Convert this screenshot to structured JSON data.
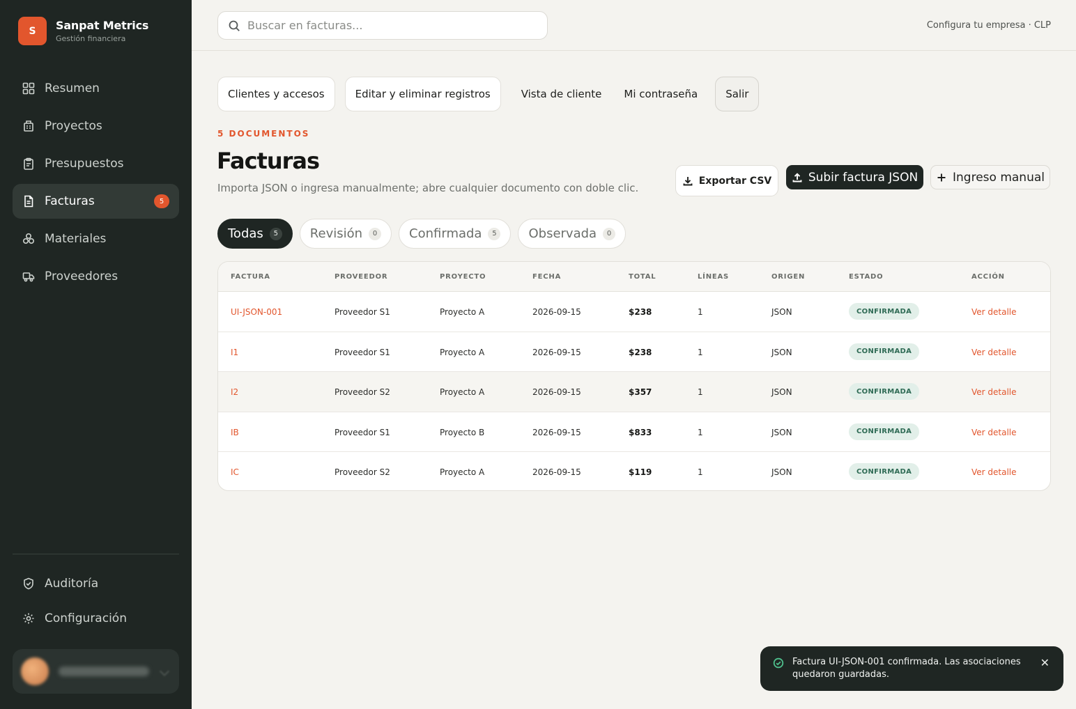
{
  "brand": {
    "logo_letter": "S",
    "name": "Sanpat Metrics",
    "subtitle": "Gestión financiera"
  },
  "sidebar": {
    "items": [
      {
        "label": "Resumen",
        "icon": "grid-icon"
      },
      {
        "label": "Proyectos",
        "icon": "building-icon"
      },
      {
        "label": "Presupuestos",
        "icon": "clipboard-icon"
      },
      {
        "label": "Facturas",
        "icon": "document-icon",
        "badge": "5",
        "active": true
      },
      {
        "label": "Materiales",
        "icon": "cluster-icon"
      },
      {
        "label": "Proveedores",
        "icon": "truck-icon"
      }
    ],
    "bottom_items": [
      {
        "label": "Auditoría",
        "icon": "shield-icon"
      },
      {
        "label": "Configuración",
        "icon": "gear-icon"
      }
    ]
  },
  "topbar": {
    "search_placeholder": "Buscar en facturas...",
    "company": "Configura tu empresa · CLP"
  },
  "top_actions": {
    "clients": "Clientes y accesos",
    "edit": "Editar y eliminar registros",
    "client_view": "Vista de cliente",
    "password": "Mi contraseña",
    "exit": "Salir"
  },
  "header": {
    "eyebrow": "5 DOCUMENTOS",
    "title": "Facturas",
    "description": "Importa JSON o ingresa manualmente; abre cualquier documento con doble clic.",
    "export_label": "Exportar CSV",
    "upload_label": "Subir factura JSON",
    "manual_label": "Ingreso manual"
  },
  "tabs": [
    {
      "label": "Todas",
      "count": "5",
      "active": true
    },
    {
      "label": "Revisión",
      "count": "0"
    },
    {
      "label": "Confirmada",
      "count": "5"
    },
    {
      "label": "Observada",
      "count": "0"
    }
  ],
  "table": {
    "columns": [
      "FACTURA",
      "PROVEEDOR",
      "PROYECTO",
      "FECHA",
      "TOTAL",
      "LÍNEAS",
      "ORIGEN",
      "ESTADO",
      "ACCIÓN"
    ],
    "rows": [
      {
        "factura": "UI-JSON-001",
        "proveedor": "Proveedor S1",
        "proyecto": "Proyecto A",
        "fecha": "2026-09-15",
        "total": "$238",
        "lineas": "1",
        "origen": "JSON",
        "estado": "CONFIRMADA",
        "accion": "Ver detalle"
      },
      {
        "factura": "I1",
        "proveedor": "Proveedor S1",
        "proyecto": "Proyecto A",
        "fecha": "2026-09-15",
        "total": "$238",
        "lineas": "1",
        "origen": "JSON",
        "estado": "CONFIRMADA",
        "accion": "Ver detalle"
      },
      {
        "factura": "I2",
        "proveedor": "Proveedor S2",
        "proyecto": "Proyecto A",
        "fecha": "2026-09-15",
        "total": "$357",
        "lineas": "1",
        "origen": "JSON",
        "estado": "CONFIRMADA",
        "accion": "Ver detalle"
      },
      {
        "factura": "IB",
        "proveedor": "Proveedor S1",
        "proyecto": "Proyecto B",
        "fecha": "2026-09-15",
        "total": "$833",
        "lineas": "1",
        "origen": "JSON",
        "estado": "CONFIRMADA",
        "accion": "Ver detalle"
      },
      {
        "factura": "IC",
        "proveedor": "Proveedor S2",
        "proyecto": "Proyecto A",
        "fecha": "2026-09-15",
        "total": "$119",
        "lineas": "1",
        "origen": "JSON",
        "estado": "CONFIRMADA",
        "accion": "Ver detalle"
      }
    ]
  },
  "toast": {
    "message": "Factura UI-JSON-001 confirmada. Las asociaciones quedaron guardadas.",
    "close": "✕"
  },
  "colors": {
    "accent": "#e2562d",
    "sidebar": "#1f2623",
    "success": "#2f6b55"
  }
}
